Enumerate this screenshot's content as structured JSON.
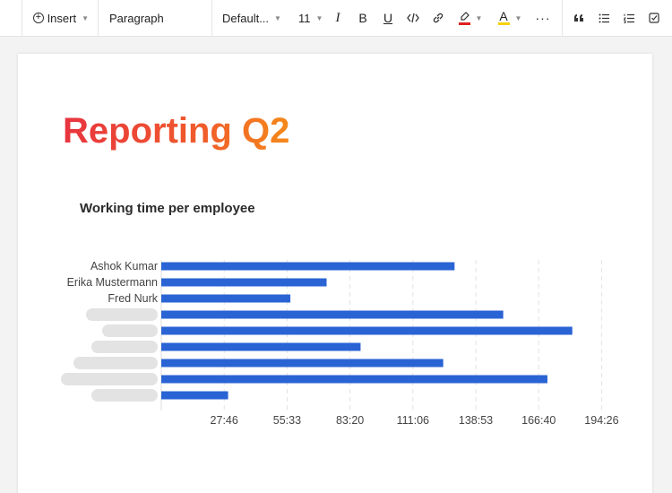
{
  "toolbar": {
    "insert_label": "Insert",
    "block_format": "Paragraph",
    "font_family": "Default...",
    "font_size": "11",
    "italic_glyph": "I",
    "bold_glyph": "B",
    "underline_glyph": "U",
    "text_color_glyph": "A",
    "more_glyph": "···",
    "highlight_color": "#e02020",
    "text_color": "#f5d000"
  },
  "document": {
    "title": "Reporting Q2",
    "title_gradient": [
      "#e8343f",
      "#f5891a"
    ]
  },
  "chart_data": {
    "type": "bar",
    "orientation": "horizontal",
    "title": "Working time per employee",
    "bar_color": "#2a63d4",
    "categories": [
      "Ashok Kumar",
      "Erika Mustermann",
      "Fred Nurk",
      "",
      "",
      "",
      "",
      "",
      ""
    ],
    "redacted": [
      false,
      false,
      false,
      true,
      true,
      true,
      true,
      true,
      true
    ],
    "values": [
      129.5,
      73.0,
      57.0,
      151.0,
      181.5,
      88.0,
      124.5,
      170.5,
      29.5
    ],
    "xlim": [
      0,
      199.8
    ],
    "xticks": [
      27.77,
      55.55,
      83.33,
      111.1,
      138.88,
      166.67,
      194.43
    ],
    "xtick_labels": [
      "27:46",
      "55:33",
      "83:20",
      "111:06",
      "138:53",
      "166:40",
      "194:26"
    ],
    "grid": true
  }
}
